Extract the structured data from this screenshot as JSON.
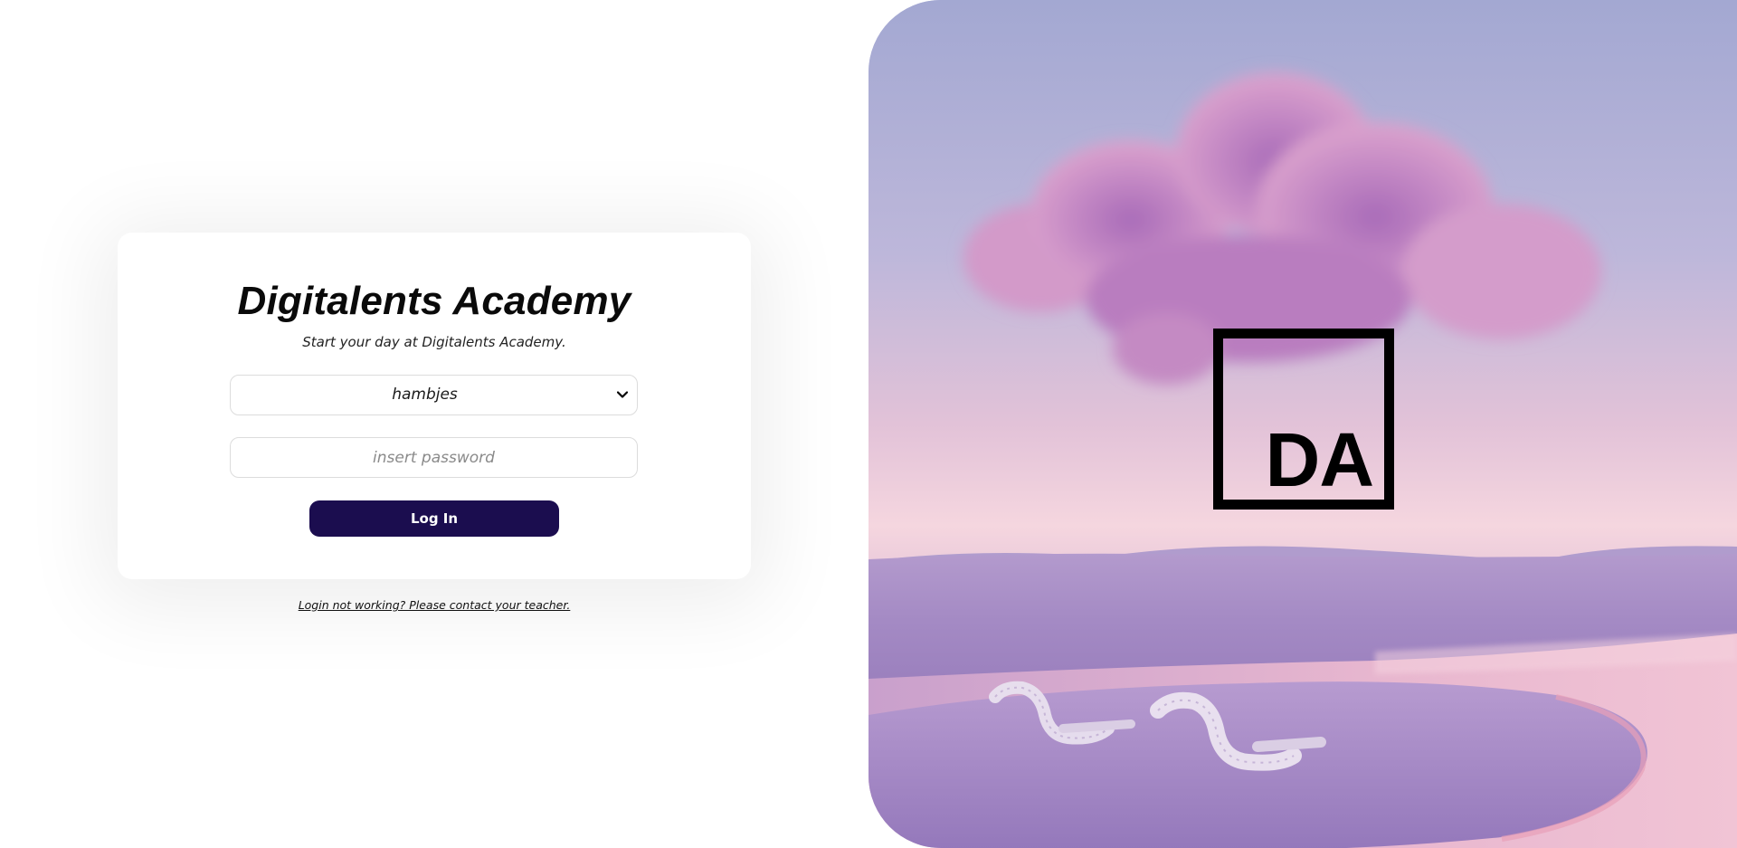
{
  "login": {
    "title": "Digitalents Academy",
    "subtitle": "Start your day at Digitalents Academy.",
    "user_select": {
      "selected": "hambjes"
    },
    "password": {
      "placeholder": "insert password",
      "value": ""
    },
    "login_button": "Log In",
    "help_link": "Login not working? Please contact your teacher."
  },
  "hero": {
    "logo_text": "DA",
    "icons": {
      "select_arrow": "chevron-down-icon"
    }
  },
  "colors": {
    "button": "#1b0d4f",
    "sky_top": "#a4a9d3",
    "grass": "#a98bc3",
    "water": "#e8b6cc",
    "cloud": "#c98bc6"
  }
}
